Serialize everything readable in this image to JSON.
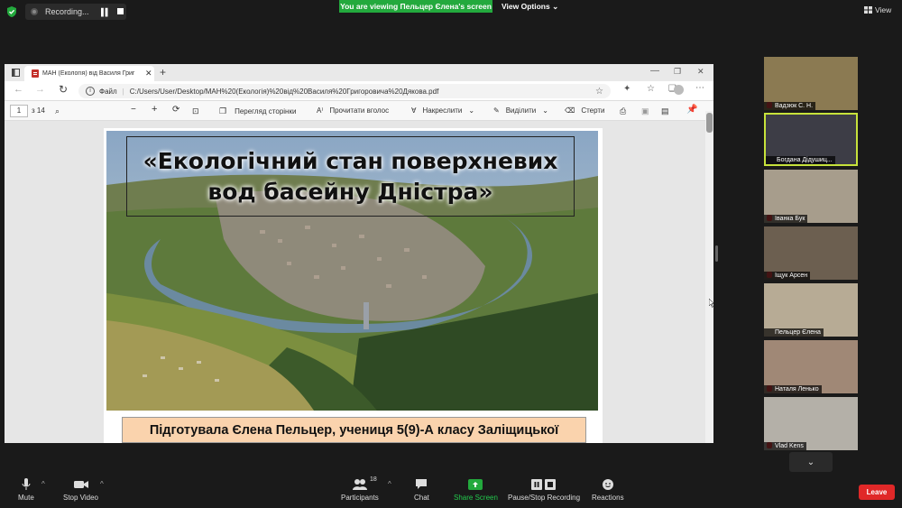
{
  "recording": {
    "label": "Recording..."
  },
  "banner": {
    "viewing": "You are viewing Пельцер Єлена's screen",
    "view_options": "View Options"
  },
  "view_button": {
    "label": "View"
  },
  "browser": {
    "tab_title": "МАН (Екологія) від Василя Григ",
    "address_prefix": "Файл",
    "url": "C:/Users/User/Desktop/МАН%20(Екологія)%20від%20Василя%20Григоровича%20Дякова.pdf"
  },
  "pdf_toolbar": {
    "page": "1",
    "page_of": "з 14",
    "page_view": "Перегляд сторінки",
    "read_aloud": "Прочитати вголос",
    "draw": "Накреслити",
    "highlight": "Виділити",
    "erase": "Стерти"
  },
  "slide": {
    "title_line1": "«Екологічний стан поверхневих",
    "title_line2": "вод басейну Дністра»",
    "byline": "Підготувала Єлена Пельцер, учениця 5(9)-А класу Заліщицької"
  },
  "participants_gallery": [
    {
      "name": "Вадзюк С. Н."
    },
    {
      "name": "Богдана Дідушиц..."
    },
    {
      "name": "Іванка Бук"
    },
    {
      "name": "Іщук Арсен"
    },
    {
      "name": "Пельцер Єлена"
    },
    {
      "name": "Наталя Ленько"
    },
    {
      "name": "Vlad Kens"
    }
  ],
  "controls": {
    "mute": "Mute",
    "stop_video": "Stop Video",
    "participants": "Participants",
    "participants_count": "18",
    "chat": "Chat",
    "share_screen": "Share Screen",
    "pause_stop_recording": "Pause/Stop Recording",
    "reactions": "Reactions",
    "leave": "Leave"
  },
  "colors": {
    "share_green": "#23a93d",
    "leave_red": "#e02828",
    "active_border": "#c7e23b",
    "byline_bg": "#fad3ad"
  }
}
